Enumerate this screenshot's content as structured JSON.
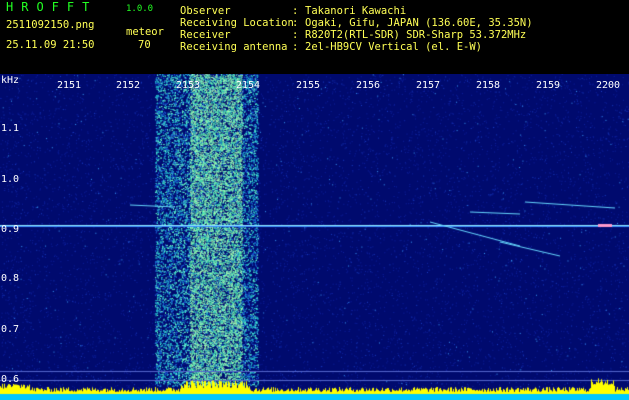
{
  "header": {
    "logo": "HROFFT",
    "version": "1.0.0",
    "filename": "2511092150.png",
    "datetime": "25.11.09 21:50",
    "meteor_label": "meteor",
    "meteor_count": "70"
  },
  "station_info": [
    {
      "label": "Observer",
      "value": "Takanori Kawachi"
    },
    {
      "label": "Receiving Location",
      "value": "Ogaki, Gifu, JAPAN (136.60E, 35.35N)"
    },
    {
      "label": "Receiver",
      "value": "R820T2(RTL-SDR) SDR-Sharp 53.372MHz"
    },
    {
      "label": "Receiving antenna",
      "value": "2el-HB9CV Vertical (el. E-W)"
    }
  ],
  "colon": ":",
  "spectrogram": {
    "freq_unit": "kHz",
    "time_ticks": [
      "2151",
      "2152",
      "2153",
      "2154",
      "2155",
      "2156",
      "2157",
      "2158",
      "2159",
      "2200"
    ],
    "freq_ticks": [
      "1.1",
      "1.0",
      "0.9",
      "0.8",
      "0.7",
      "0.6"
    ]
  },
  "colors": {
    "background": "#000000",
    "spectrogram_base": "#000a6e",
    "carrier_line": "#8fe8ff",
    "noise_band": "#33ddaa",
    "baseline": "#ffff00",
    "header_green": "#22ff22",
    "header_yellow": "#ffff55"
  }
}
